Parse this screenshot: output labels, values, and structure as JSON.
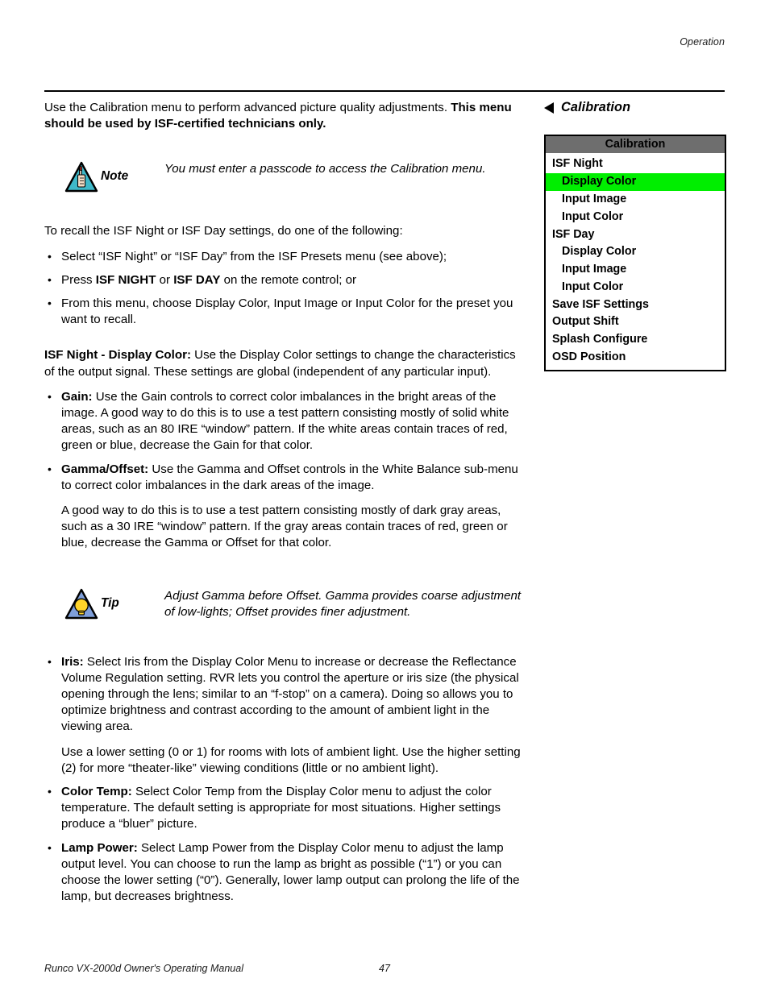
{
  "header": {
    "running_head": "Operation"
  },
  "footer": {
    "manual_title": "Runco VX-2000d Owner's Operating Manual",
    "page_number": "47"
  },
  "colors": {
    "osd_title_bar": "#6e6e6e",
    "osd_selected_row": "#00ee00",
    "note_icon_fill": "#3fb9c9",
    "tip_icon_fill": "#7f9fd9",
    "tip_bulb": "#ffd42a",
    "text": "#000000"
  },
  "main": {
    "intro": {
      "plain": "Use the Calibration menu to perform advanced picture quality adjustments. ",
      "bold": "This menu should be used by ISF-certified technicians only."
    },
    "note": {
      "icon": "note-triangle-hand-icon",
      "label": "Note",
      "text": "You must enter a passcode to access the Calibration menu."
    },
    "recall_intro": "To recall the ISF Night or ISF Day settings, do one of the following:",
    "recall_bullets": [
      {
        "segments": [
          {
            "text": "Select “ISF Night” or “ISF Day” from the ISF Presets menu (see above);",
            "bold": false
          }
        ]
      },
      {
        "segments": [
          {
            "text": "Press ",
            "bold": false
          },
          {
            "text": "ISF NIGHT",
            "bold": true
          },
          {
            "text": " or ",
            "bold": false
          },
          {
            "text": "ISF DAY",
            "bold": true
          },
          {
            "text": " on the remote control; or",
            "bold": false
          }
        ]
      },
      {
        "segments": [
          {
            "text": "From this menu, choose Display Color, Input Image or Input Color for the preset you want to recall.",
            "bold": false
          }
        ]
      }
    ],
    "display_color_para": {
      "bold": "ISF Night - Display Color:",
      "plain": " Use the Display Color settings to change the characteristics of the output signal. These settings are global (independent of any particular input)."
    },
    "gain_gamma_bullets": [
      {
        "term": "Gain:",
        "text": " Use the Gain controls to correct color imbalances in the bright areas of the image. A good way to do this is to use a test pattern consisting mostly of solid white areas, such as an 80 IRE “window” pattern. If the white areas contain traces of red, green or blue, decrease the Gain for that color.",
        "sub": ""
      },
      {
        "term": "Gamma/Offset:",
        "text": " Use the Gamma and Offset controls in the White Balance sub-menu to correct color imbalances in the dark areas of the image.",
        "sub": "A good way to do this is to use a test pattern consisting mostly of dark gray areas, such as a 30 IRE “window” pattern. If the gray areas contain traces of red, green or blue, decrease the Gamma or Offset for that color."
      }
    ],
    "tip": {
      "icon": "tip-triangle-bulb-icon",
      "label": "Tip",
      "text": "Adjust Gamma before Offset. Gamma provides coarse adjustment of low-lights; Offset provides finer adjustment."
    },
    "iris_bullets": [
      {
        "term": "Iris:",
        "text": " Select Iris from the Display Color Menu to increase or decrease the Reflectance Volume Regulation setting. RVR lets you control the aperture or iris size (the physical opening through the lens; similar to an “f-stop” on a camera). Doing so allows you to optimize brightness and contrast according to the amount of ambient light in the viewing area.",
        "sub": "Use a lower setting (0 or 1) for rooms with lots of ambient light. Use the higher setting (2) for more “theater-like” viewing conditions (little or no ambient light)."
      },
      {
        "term": "Color Temp:",
        "text": " Select Color Temp from the Display Color menu to adjust the color temperature. The default setting is appropriate for most situations. Higher settings produce a “bluer” picture.",
        "sub": ""
      },
      {
        "term": "Lamp Power:",
        "text": " Select Lamp Power from the Display Color menu to adjust the lamp output level. You can choose to run the lamp as bright as possible (“1”) or you can choose the lower setting (“0”). Generally, lower lamp output can prolong the life of the lamp, but decreases brightness.",
        "sub": ""
      }
    ]
  },
  "sidebar": {
    "heading": "Calibration",
    "heading_icon": "left-arrow-icon",
    "osd": {
      "title": "Calibration",
      "items": [
        {
          "label": "ISF Night",
          "level": 1,
          "selected": false
        },
        {
          "label": "Display Color",
          "level": 2,
          "selected": true
        },
        {
          "label": "Input Image",
          "level": 2,
          "selected": false
        },
        {
          "label": "Input Color",
          "level": 2,
          "selected": false
        },
        {
          "label": "ISF Day",
          "level": 1,
          "selected": false
        },
        {
          "label": "Display Color",
          "level": 2,
          "selected": false
        },
        {
          "label": "Input Image",
          "level": 2,
          "selected": false
        },
        {
          "label": "Input Color",
          "level": 2,
          "selected": false
        },
        {
          "label": "Save ISF Settings",
          "level": 0,
          "selected": false
        },
        {
          "label": "Output Shift",
          "level": 0,
          "selected": false
        },
        {
          "label": "Splash Configure",
          "level": 0,
          "selected": false
        },
        {
          "label": "OSD Position",
          "level": 0,
          "selected": false
        }
      ]
    }
  }
}
